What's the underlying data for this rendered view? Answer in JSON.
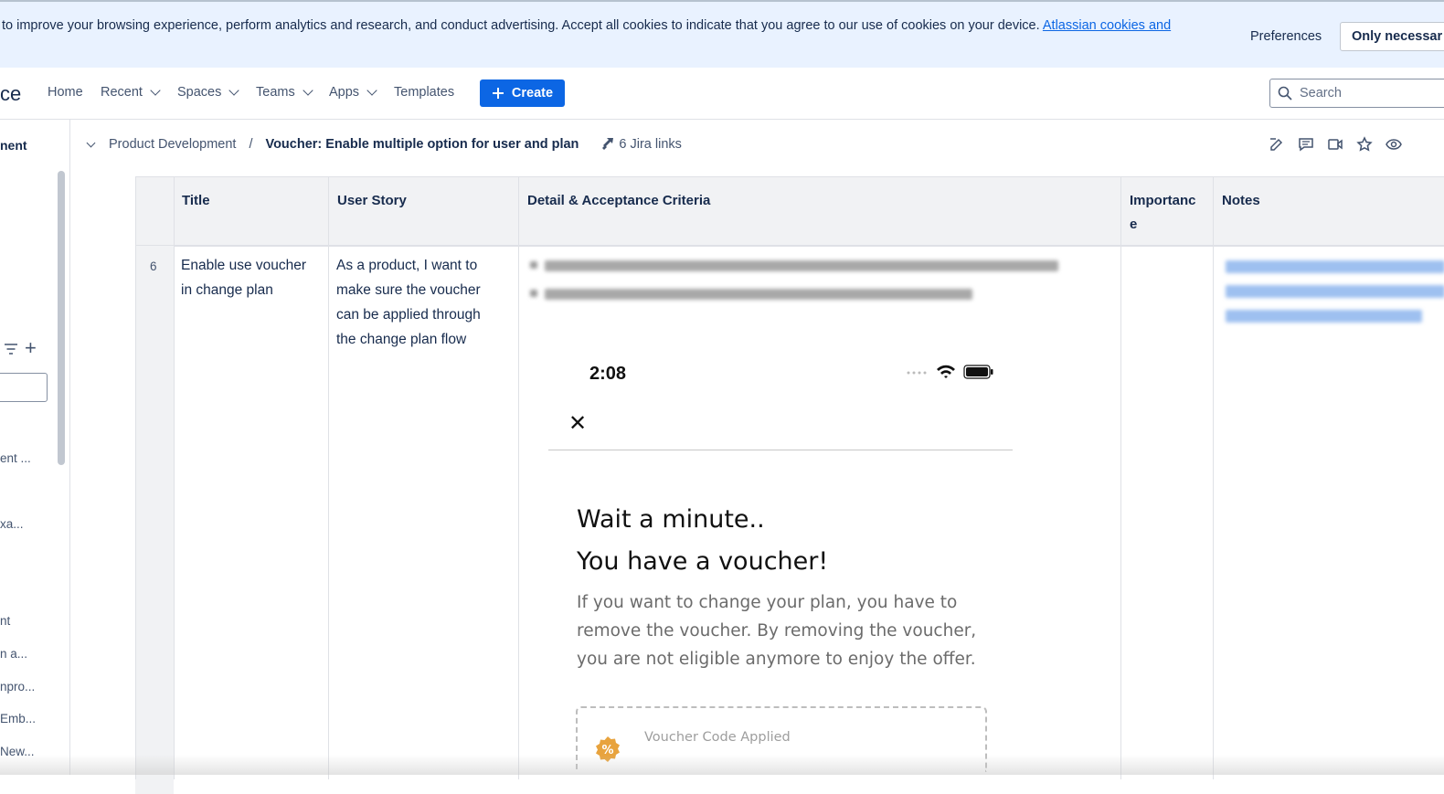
{
  "cookie_banner": {
    "text": "to improve your browsing experience, perform analytics and research, and conduct advertising. Accept all cookies to indicate that you agree to our use of cookies on your device.",
    "link": "Atlassian cookies and",
    "preferences_label": "Preferences",
    "only_necessary_label": "Only necessar"
  },
  "topnav": {
    "logo_text": "ce",
    "items": [
      "Home",
      "Recent",
      "Spaces",
      "Teams",
      "Apps",
      "Templates"
    ],
    "create_label": "Create",
    "search_placeholder": "Search"
  },
  "sidebar": {
    "space_name": "nent",
    "items": [
      "ent ...",
      "xa...",
      "nt",
      "n a...",
      "npro...",
      "Emb...",
      "New..."
    ]
  },
  "breadcrumb": {
    "parent": "Product Development",
    "separator": "/",
    "current": "Voucher: Enable multiple option for user and plan",
    "jira_links": "6 Jira links"
  },
  "table": {
    "headers": [
      "Title",
      "User Story",
      "Detail & Acceptance Criteria",
      "Importanc e",
      "Notes"
    ],
    "row": {
      "number": "6",
      "title": "Enable use voucher in change plan",
      "user_story": "As a product, I want to make sure the voucher can be applied through the change plan flow"
    }
  },
  "phone_mock": {
    "time": "2:08",
    "close": "✕",
    "heading_line1": "Wait a minute..",
    "heading_line2": "You have a voucher!",
    "body": "If you want to change your plan, you have to remove the voucher. By removing the voucher, you are not eligible anymore to enjoy the offer.",
    "voucher_label": "Voucher Code Applied",
    "voucher_icon": "%"
  },
  "colors": {
    "accent": "#0c66e4",
    "banner_bg": "#e9f2ff",
    "header_bg": "#f1f2f4",
    "voucher_badge": "#e8a33d"
  },
  "icons": [
    "search-icon",
    "plus-icon",
    "chevron-down-icon",
    "filter-icon",
    "jira-icon",
    "edit-icon",
    "comment-icon",
    "video-icon",
    "star-icon",
    "watch-icon",
    "wifi-icon",
    "battery-icon",
    "close-icon",
    "discount-badge-icon"
  ]
}
